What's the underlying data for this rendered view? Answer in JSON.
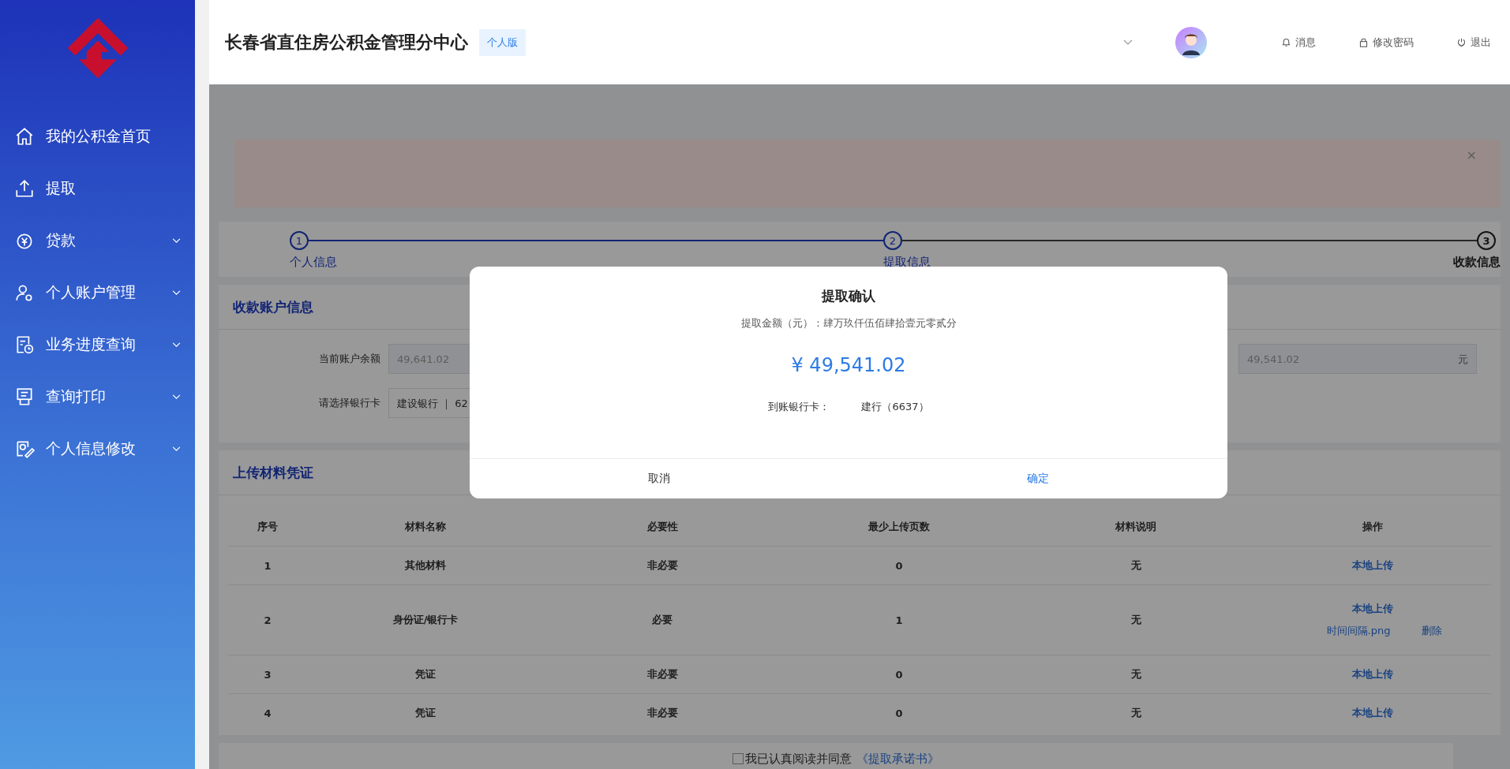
{
  "sidebar": {
    "items": [
      {
        "label": "我的公积金首页",
        "expandable": false
      },
      {
        "label": "提取",
        "expandable": false
      },
      {
        "label": "贷款",
        "expandable": true
      },
      {
        "label": "个人账户管理",
        "expandable": true
      },
      {
        "label": "业务进度查询",
        "expandable": true
      },
      {
        "label": "查询打印",
        "expandable": true
      },
      {
        "label": "个人信息修改",
        "expandable": true
      }
    ]
  },
  "header": {
    "title": "长春省直住房公积金管理分中心",
    "badge": "个人版",
    "links": [
      {
        "label": "消息"
      },
      {
        "label": "修改密码"
      },
      {
        "label": "退出"
      }
    ]
  },
  "notice": {
    "close": "×"
  },
  "steps": [
    {
      "number": "1",
      "label": "个人信息",
      "current": false
    },
    {
      "number": "2",
      "label": "提取信息",
      "current": false
    },
    {
      "number": "3",
      "label": "收款信息",
      "current": true
    }
  ],
  "account_card": {
    "title": "收款账户信息",
    "balance_label": "当前账户余额",
    "balance": "49,641.02",
    "amount": "49,541.02",
    "unit": "元",
    "card_label": "请选择银行卡",
    "card": "建设银行 ｜ 62"
  },
  "upload_card": {
    "title": "上传材料凭证",
    "columns": [
      "序号",
      "材料名称",
      "必要性",
      "最少上传页数",
      "材料说明",
      "操作"
    ],
    "rows": [
      {
        "cells": [
          "1",
          "其他材料",
          "非必要",
          "0",
          "无"
        ],
        "actions": [
          {
            "label": "本地上传",
            "kind": "upload"
          }
        ]
      },
      {
        "cells": [
          "2",
          "身份证/银行卡",
          "必要",
          "1",
          "无"
        ],
        "actions": [
          {
            "label": "本地上传",
            "kind": "upload"
          },
          {
            "label": "时间间隔.png",
            "kind": "file"
          },
          {
            "label": "删除",
            "kind": "delete"
          }
        ]
      },
      {
        "cells": [
          "3",
          "凭证",
          "非必要",
          "0",
          "无"
        ],
        "actions": [
          {
            "label": "本地上传",
            "kind": "upload"
          }
        ]
      },
      {
        "cells": [
          "4",
          "凭证",
          "非必要",
          "0",
          "无"
        ],
        "actions": [
          {
            "label": "本地上传",
            "kind": "upload"
          }
        ]
      }
    ]
  },
  "agreement": {
    "checked": false,
    "text": "我已认真阅读并同意",
    "link": "《提取承诺书》"
  },
  "modal": {
    "title": "提取确认",
    "amount_words": "提取金额（元）：肆万玖仟伍佰肆拾壹元零贰分",
    "amount": "¥ 49,541.02",
    "bank_label": "到账银行卡：",
    "bank": "建行（6637）",
    "cancel": "取消",
    "confirm": "确定"
  }
}
